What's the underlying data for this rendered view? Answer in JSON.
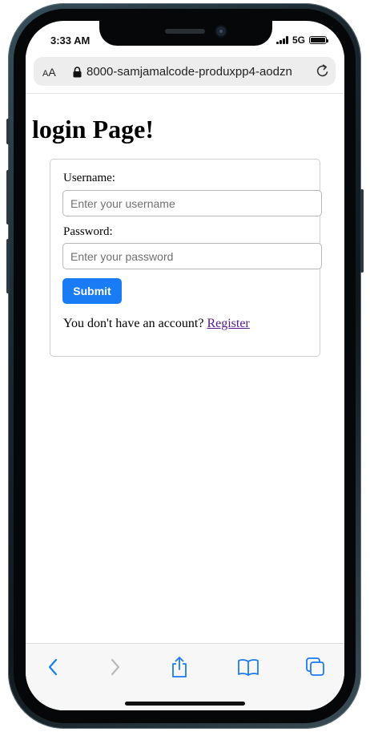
{
  "status_bar": {
    "time": "3:33 AM",
    "network": "5G"
  },
  "browser": {
    "text_size_label_small": "A",
    "text_size_label_large": "A",
    "url": "8000-samjamalcode-produxpp4-aodzn"
  },
  "page": {
    "title": "login Page!",
    "form": {
      "username_label": "Username:",
      "username_placeholder": "Enter your username",
      "password_label": "Password:",
      "password_placeholder": "Enter your password",
      "submit_label": "Submit",
      "register_prompt": "You don't have an account? ",
      "register_link": "Register"
    }
  },
  "toolbar": {
    "icons": [
      "back-icon",
      "forward-icon",
      "share-icon",
      "bookmarks-icon",
      "tabs-icon"
    ]
  },
  "colors": {
    "submit_button": "#1a7cf5",
    "link_visited": "#551a8b",
    "toolbar_icon": "#1a7cf5",
    "toolbar_icon_disabled": "#b9b9b9"
  }
}
